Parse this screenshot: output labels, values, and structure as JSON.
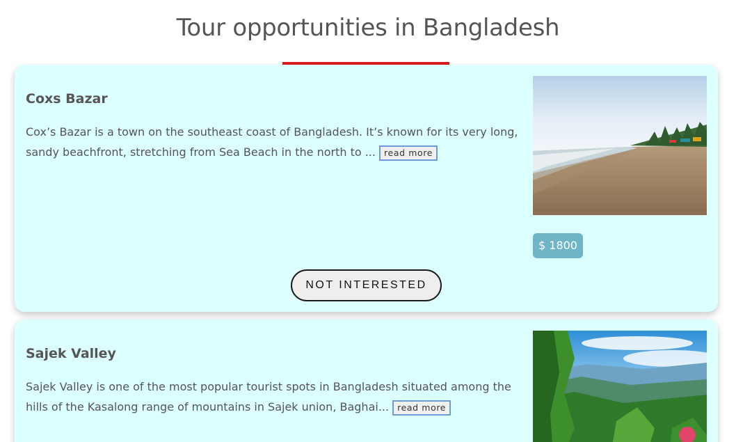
{
  "page": {
    "title": "Tour opportunities in Bangladesh",
    "accent_color": "#e01b1b",
    "card_background": "#dcffff"
  },
  "tours": [
    {
      "name": "Coxs Bazar",
      "description": "Cox’s Bazar is a town on the southeast coast of Bangladesh. It’s known for its very long, sandy beachfront, stretching from Sea Beach in the north to ...",
      "read_more_label": "read more",
      "price": "$ 1800",
      "not_interested_label": "NOT INTERESTED",
      "image_alt": "beach"
    },
    {
      "name": "Sajek Valley",
      "description": "Sajek Valley is one of the most popular tourist spots in Bangladesh situated among the hills of the Kasalong range of mountains in Sajek union, Baghai...",
      "read_more_label": "read more",
      "image_alt": "green hills"
    }
  ]
}
